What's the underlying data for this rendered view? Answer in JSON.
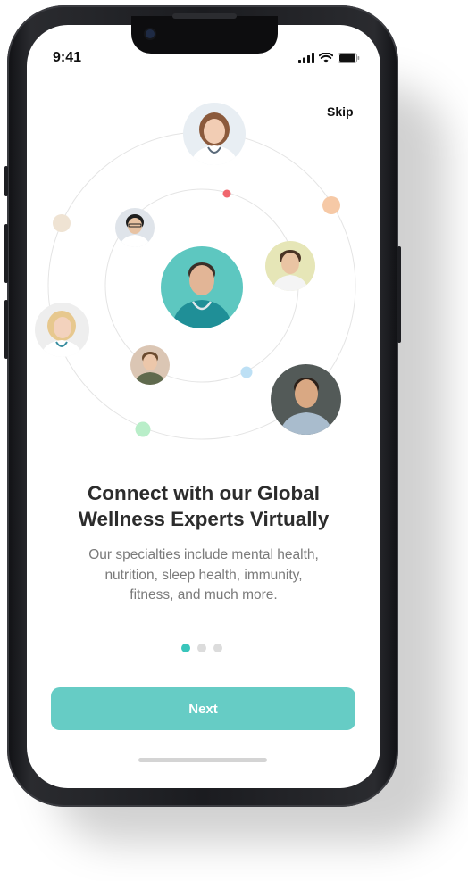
{
  "status_bar": {
    "time": "9:41"
  },
  "header": {
    "skip_label": "Skip"
  },
  "onboarding": {
    "title_line1": "Connect with our Global",
    "title_line2": "Wellness Experts Virtually",
    "subtitle_line1": "Our specialties include mental health,",
    "subtitle_line2": "nutrition, sleep health, immunity,",
    "subtitle_line3": "fitness, and much more."
  },
  "pagination": {
    "total": 3,
    "active_index": 0
  },
  "actions": {
    "next_label": "Next"
  },
  "colors": {
    "accent": "#39c5bb",
    "button": "#66ccc5",
    "title": "#2c2c2c",
    "subtitle": "#7a7a7a",
    "orbit_dot_red": "#f0666d",
    "orbit_dot_orange": "#f6c9a6",
    "orbit_dot_beige": "#efe3d3",
    "orbit_dot_blue": "#bde0f5",
    "orbit_dot_green": "#b9eec9"
  }
}
